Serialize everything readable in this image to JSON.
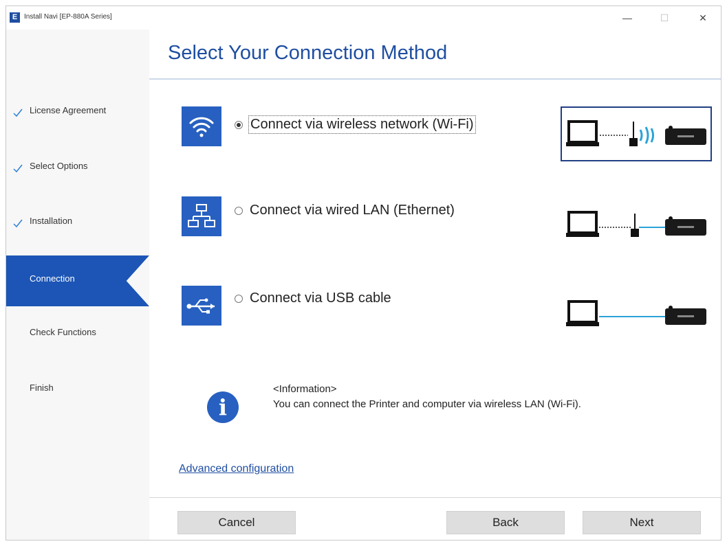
{
  "window": {
    "title": "Install Navi [EP-880A Series]",
    "app_icon_letter": "E"
  },
  "controls": {
    "minimize": "—",
    "maximize": "☐",
    "close": "✕"
  },
  "sidebar": {
    "steps": [
      {
        "label": "License Agreement",
        "state": "done"
      },
      {
        "label": "Select Options",
        "state": "done"
      },
      {
        "label": "Installation",
        "state": "done"
      },
      {
        "label": "Connection",
        "state": "active"
      },
      {
        "label": "Check Functions",
        "state": "pending"
      },
      {
        "label": "Finish",
        "state": "pending"
      }
    ]
  },
  "main": {
    "title": "Select Your Connection Method",
    "options": [
      {
        "label": "Connect via wireless network (Wi-Fi)",
        "icon": "wifi-icon",
        "selected": true
      },
      {
        "label": "Connect via wired LAN (Ethernet)",
        "icon": "network-icon",
        "selected": false
      },
      {
        "label": "Connect via USB cable",
        "icon": "usb-icon",
        "selected": false
      }
    ],
    "info": {
      "icon": "info-icon",
      "glyph": "i",
      "heading": "<Information>",
      "text": "You can connect the Printer and computer via wireless LAN (Wi-Fi)."
    },
    "advanced_link": "Advanced configuration"
  },
  "buttons": {
    "cancel": "Cancel",
    "back": "Back",
    "next": "Next"
  },
  "colors": {
    "accent": "#1c55b5",
    "title": "#1f4ea1",
    "icon_bg": "#2760c0",
    "usb_line": "#2aa3d8"
  }
}
